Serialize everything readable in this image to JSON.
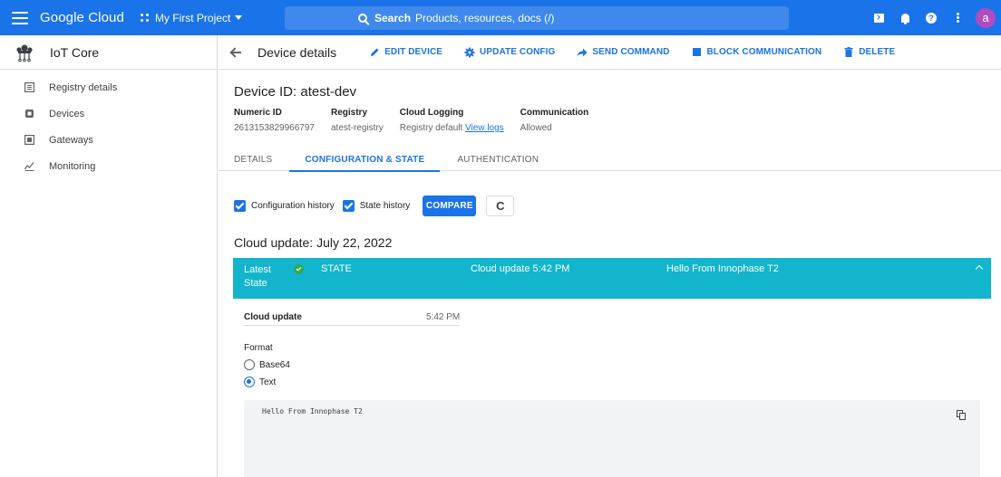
{
  "topbar": {
    "brand": "Google Cloud",
    "project": "My First Project",
    "search_label": "Search",
    "search_hint": "Products, resources, docs (/)",
    "avatar_letter": "a"
  },
  "sidenav": {
    "product": "IoT Core",
    "items": [
      {
        "label": "Registry details",
        "icon": "registry-icon"
      },
      {
        "label": "Devices",
        "icon": "device-icon"
      },
      {
        "label": "Gateways",
        "icon": "gateway-icon"
      },
      {
        "label": "Monitoring",
        "icon": "monitoring-icon"
      }
    ]
  },
  "actionbar": {
    "title": "Device details",
    "edit": "EDIT DEVICE",
    "update_config": "UPDATE CONFIG",
    "send_command": "SEND COMMAND",
    "block": "BLOCK COMMUNICATION",
    "delete": "DELETE"
  },
  "device": {
    "id_title": "Device ID: atest-dev",
    "meta": {
      "numeric_id_label": "Numeric ID",
      "numeric_id": "2613153829966797",
      "registry_label": "Registry",
      "registry": "atest-registry",
      "logging_label": "Cloud Logging",
      "logging_value": "Registry default",
      "logging_link": "View logs",
      "comm_label": "Communication",
      "comm_value": "Allowed"
    }
  },
  "tabs": [
    "DETAILS",
    "CONFIGURATION & STATE",
    "AUTHENTICATION"
  ],
  "filters": {
    "config_history": "Configuration history",
    "state_history": "State history",
    "compare": "COMPARE",
    "refresh_glyph": "C"
  },
  "cloud_update_title": "Cloud update: July 22, 2022",
  "state_entry": {
    "latest": "Latest State",
    "kind": "STATE",
    "cloud_update": "Cloud update 5:42 PM",
    "message": "Hello From Innophase T2",
    "detail_key": "Cloud update",
    "detail_value": "5:42 PM",
    "format_label": "Format",
    "format_options": [
      "Base64",
      "Text"
    ],
    "selected_format": "Text",
    "payload": "Hello From Innophase T2"
  },
  "colors": {
    "topbar": "#1a73e8",
    "accent": "#1a73e8",
    "state_header": "#12b5cb",
    "ok": "#34a853"
  }
}
